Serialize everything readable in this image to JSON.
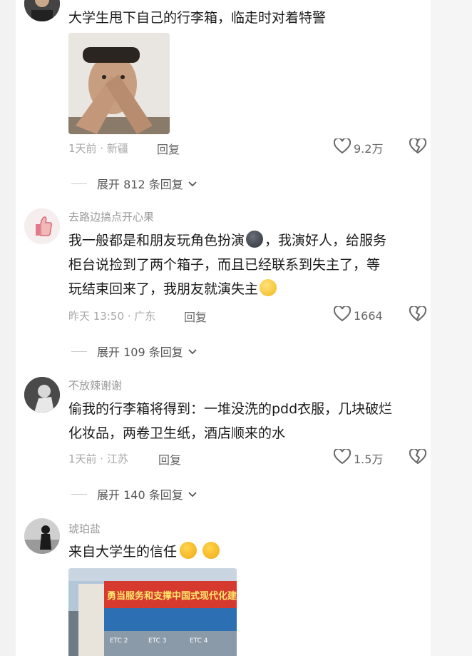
{
  "comments": [
    {
      "text": "大学生甩下自己的行李箱，临走时对着特警",
      "meta": "1天前 · 新疆",
      "reply_label": "回复",
      "likes": "9.2万",
      "expand_label": "展开 812 条回复"
    },
    {
      "username": "去路边搞点开心果",
      "text_lines": [
        "我一般都是和朋友玩角色扮演",
        "，我演好人，给服务",
        "柜台说捡到了两个箱子，而且已经联系到失主了，等",
        "玩结束回来了，我朋友就演失主"
      ],
      "meta": "昨天 13:50 · 广东",
      "reply_label": "回复",
      "likes": "1664",
      "expand_label": "展开 109 条回复"
    },
    {
      "username": "不放辣谢谢",
      "text_lines": [
        "偷我的行李箱将得到：一堆没洗的pdd衣服，几块破烂",
        "化妆品，两卷卫生纸，酒店顺来的水"
      ],
      "meta": "1天前 · 江苏",
      "reply_label": "回复",
      "likes": "1.5万",
      "expand_label": "展开 140 条回复"
    },
    {
      "username": "琥珀盐",
      "text": "来自大学生的信任",
      "banner_text": "勇当服务和支撑中国式现代化建设",
      "gate_labels": [
        "ETC 2",
        "ETC 3",
        "ETC 4"
      ]
    }
  ]
}
